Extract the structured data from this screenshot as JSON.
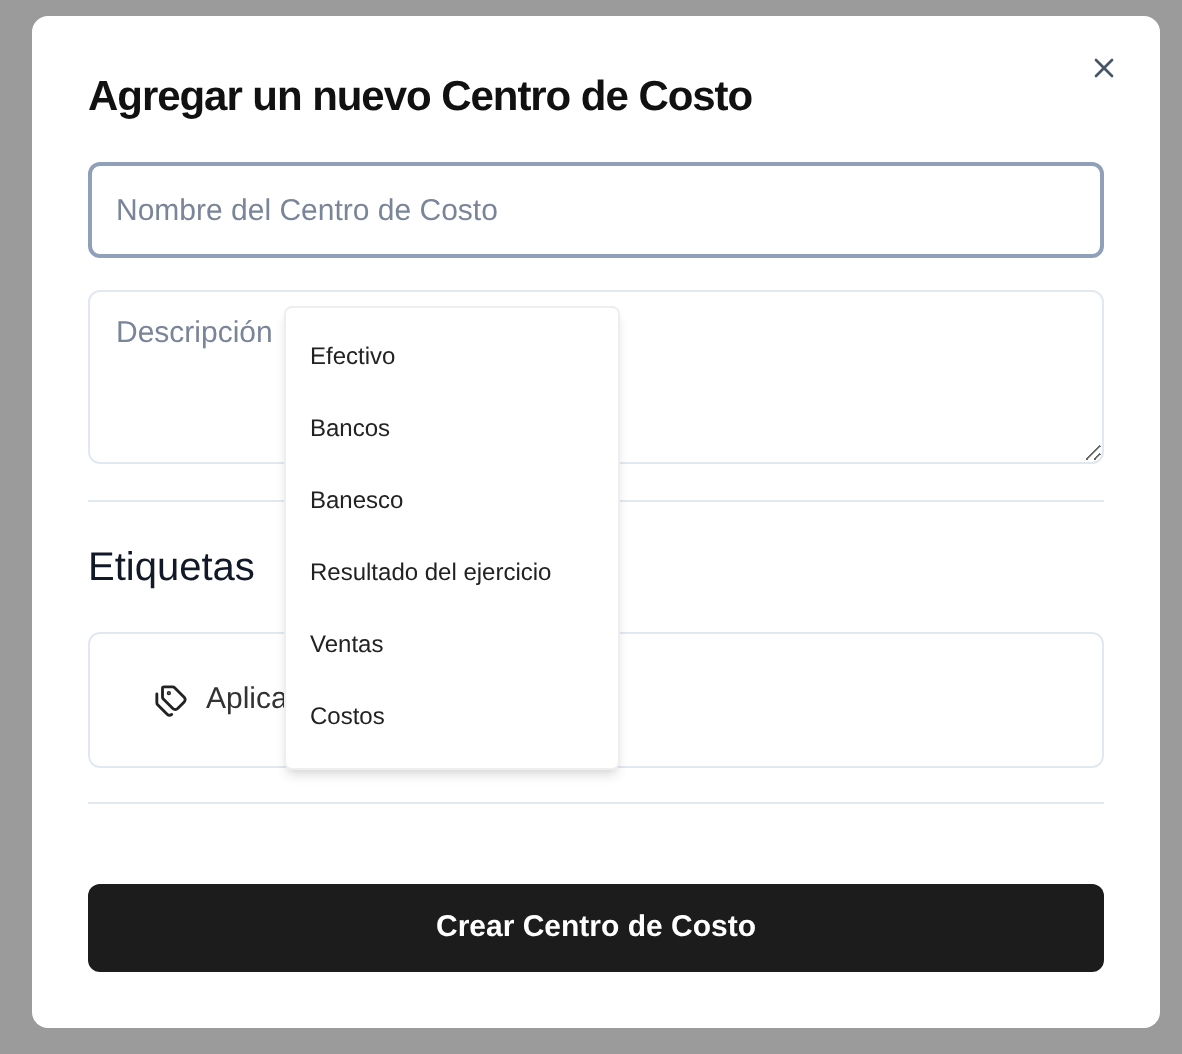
{
  "dialog": {
    "title": "Agregar un nuevo Centro de Costo"
  },
  "name_field": {
    "placeholder": "Nombre del Centro de Costo"
  },
  "description_field": {
    "placeholder": "Descripción"
  },
  "suggestions": [
    "Efectivo",
    "Bancos",
    "Banesco",
    "Resultado del ejercicio",
    "Ventas",
    "Costos"
  ],
  "tags_section": {
    "heading": "Etiquetas",
    "apply_label": "Aplica"
  },
  "submit_button": "Crear Centro de Costo"
}
